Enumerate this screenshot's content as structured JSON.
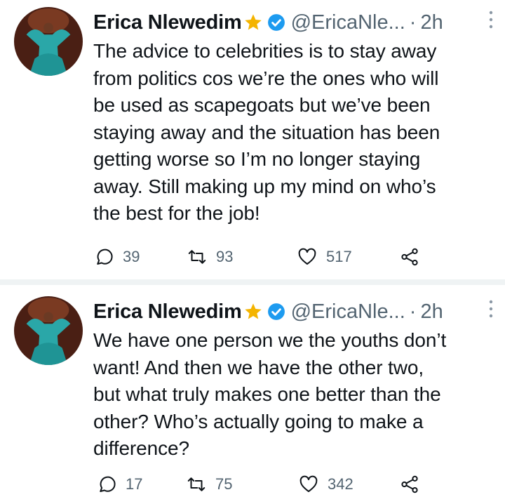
{
  "colors": {
    "text": "#0f1419",
    "muted": "#536471",
    "verified": "#1d9bf0",
    "star": "#f4b400",
    "separator": "#eff3f4",
    "avatar_dress": "#2aa7a8"
  },
  "tweets": [
    {
      "display_name": "Erica Nlewedim",
      "star_icon": "star-icon",
      "verified_icon": "verified-badge-icon",
      "handle": "@EricaNle...",
      "separator_dot": "·",
      "time": "2h",
      "text": "The advice to celebrities is to stay away\nfrom politics cos we’re the ones who will\nbe used as scapegoats but we’ve been\nstaying away and the situation has been\ngetting worse so I’m no longer staying\naway. Still making up my mind on who’s\nthe best for the job!",
      "replies": "39",
      "retweets": "93",
      "likes": "517"
    },
    {
      "display_name": "Erica Nlewedim",
      "star_icon": "star-icon",
      "verified_icon": "verified-badge-icon",
      "handle": "@EricaNle...",
      "separator_dot": "·",
      "time": "2h",
      "text": "We have one person we the youths don’t\nwant! And then we have the other two,\nbut what truly makes one better than the\nother? Who’s actually going to make a\ndifference?",
      "replies": "17",
      "retweets": "75",
      "likes": "342"
    }
  ]
}
